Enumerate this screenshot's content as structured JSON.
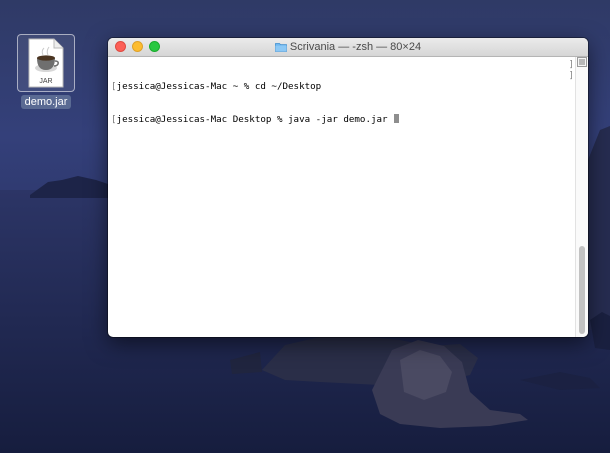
{
  "desktop": {
    "file": {
      "name": "demo.jar",
      "badge": "JAR",
      "icon": "java-jar-file-icon"
    }
  },
  "terminal": {
    "title": "Scrivania — -zsh — 80×24",
    "title_icon": "folder-icon",
    "lines": [
      "jessica@Jessicas-Mac ~ % cd ~/Desktop",
      "jessica@Jessicas-Mac Desktop % java -jar demo.jar "
    ],
    "mark_char": "[",
    "right_mark": "]"
  },
  "colors": {
    "close": "#fc5f57",
    "minimize": "#fdbc2e",
    "maximize": "#28c840"
  }
}
